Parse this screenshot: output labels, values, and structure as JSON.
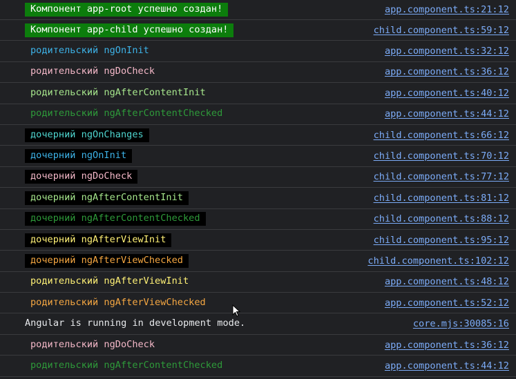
{
  "console": {
    "rows": [
      {
        "text": "Компонент app-root успешно создан!",
        "source": "app.component.ts:21:12",
        "color": "#ffffff",
        "bg": "#0c7d0c"
      },
      {
        "text": "Компонент app-child успешно создан!",
        "source": "child.component.ts:59:12",
        "color": "#ffffff",
        "bg": "#0c7d0c"
      },
      {
        "text": "родительский ngOnInit",
        "source": "app.component.ts:32:12",
        "color": "#3db3e8",
        "bg": ""
      },
      {
        "text": "родительский ngDoCheck",
        "source": "app.component.ts:36:12",
        "color": "#f4b8c8",
        "bg": ""
      },
      {
        "text": "родительский ngAfterContentInit",
        "source": "app.component.ts:40:12",
        "color": "#a6e68c",
        "bg": ""
      },
      {
        "text": "родительский ngAfterContentChecked",
        "source": "app.component.ts:44:12",
        "color": "#2e9a3a",
        "bg": ""
      },
      {
        "text": "дочерний ngOnChanges",
        "source": "child.component.ts:66:12",
        "color": "#4fd6d0",
        "bg": "#000000"
      },
      {
        "text": "дочерний ngOnInit",
        "source": "child.component.ts:70:12",
        "color": "#3db3e8",
        "bg": "#000000"
      },
      {
        "text": "дочерний ngDoCheck",
        "source": "child.component.ts:77:12",
        "color": "#f4b8c8",
        "bg": "#000000"
      },
      {
        "text": "дочерний ngAfterContentInit",
        "source": "child.component.ts:81:12",
        "color": "#a6e68c",
        "bg": "#000000"
      },
      {
        "text": "дочерний ngAfterContentChecked",
        "source": "child.component.ts:88:12",
        "color": "#2e9a3a",
        "bg": "#000000"
      },
      {
        "text": "дочерний ngAfterViewInit",
        "source": "child.component.ts:95:12",
        "color": "#fff176",
        "bg": "#000000"
      },
      {
        "text": "дочерний ngAfterViewChecked",
        "source": "child.component.ts:102:12",
        "color": "#f5a742",
        "bg": "#000000"
      },
      {
        "text": "родительский ngAfterViewInit",
        "source": "app.component.ts:48:12",
        "color": "#fff176",
        "bg": ""
      },
      {
        "text": "родительский ngAfterViewChecked",
        "source": "app.component.ts:52:12",
        "color": "#f5a742",
        "bg": ""
      },
      {
        "text": "Angular is running in development mode.",
        "source": "core.mjs:30085:16",
        "color": "#e8eaed",
        "bg": "",
        "plain": true
      },
      {
        "text": "родительский ngDoCheck",
        "source": "app.component.ts:36:12",
        "color": "#f4b8c8",
        "bg": ""
      },
      {
        "text": "родительский ngAfterContentChecked",
        "source": "app.component.ts:44:12",
        "color": "#2e9a3a",
        "bg": ""
      }
    ]
  },
  "icons": {
    "cursor": "mouse-pointer-icon"
  }
}
